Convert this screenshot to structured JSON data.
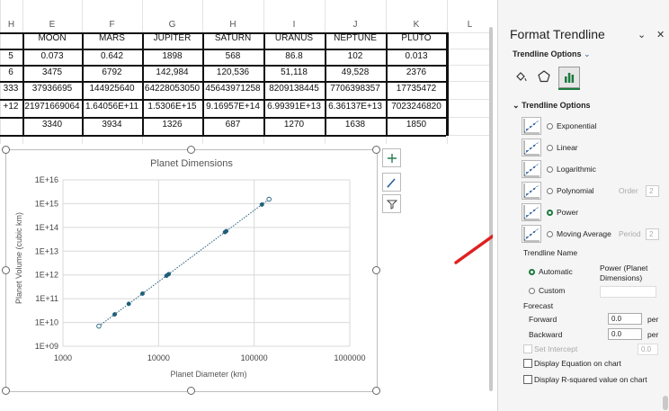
{
  "sheet": {
    "column_headers": [
      "H",
      "E",
      "F",
      "G",
      "H",
      "I",
      "J",
      "K",
      "L"
    ],
    "table_headers": [
      "MOON",
      "MARS",
      "JUPITER",
      "SATURN",
      "URANUS",
      "NEPTUNE",
      "PLUTO"
    ],
    "rows": [
      [
        "5",
        "0.073",
        "0.642",
        "1898",
        "568",
        "86.8",
        "102",
        "0.013"
      ],
      [
        "6",
        "3475",
        "6792",
        "142,984",
        "120,536",
        "51,118",
        "49,528",
        "2376"
      ],
      [
        "333",
        "37936695",
        "144925640",
        "64228053050",
        "45643971258",
        "8209138445",
        "7706398357",
        "17735472"
      ],
      [
        "+12",
        "21971669064",
        "1.64056E+11",
        "1.5306E+15",
        "9.16957E+14",
        "6.99391E+13",
        "6.36137E+13",
        "7023246820"
      ],
      [
        "",
        "3340",
        "3934",
        "1326",
        "687",
        "1270",
        "1638",
        "1850"
      ]
    ]
  },
  "chart": {
    "title": "Planet Dimensions",
    "xlabel": "Planet Diameter (km)",
    "ylabel": "Planet Volume (cubic km)"
  },
  "chart_data": {
    "type": "scatter",
    "title": "Planet Dimensions",
    "xlabel": "Planet Diameter (km)",
    "ylabel": "Planet Volume (cubic km)",
    "x_scale": "log",
    "y_scale": "log",
    "xlim": [
      1000,
      1000000
    ],
    "ylim": [
      1000000000,
      10000000000000000
    ],
    "x_ticks": [
      "1000",
      "10000",
      "100000",
      "1000000"
    ],
    "y_ticks": [
      "1E+09",
      "1E+10",
      "1E+11",
      "1E+12",
      "1E+13",
      "1E+14",
      "1E+15",
      "1E+16"
    ],
    "grid": true,
    "trendline": "power",
    "x": [
      2376,
      3475,
      4879,
      6792,
      12104,
      12756,
      49528,
      51118,
      120536,
      142984
    ],
    "y": [
      7023246820,
      21971669064,
      60830000000,
      164056000000,
      928400000000,
      1083000000000,
      63613700000000,
      69939100000000,
      916957000000000,
      1530600000000000
    ]
  },
  "pane": {
    "title": "Format Trendline",
    "tab_label": "Trendline Options",
    "section": "Trendline Options",
    "options": [
      {
        "label": "Exponential",
        "selected": false
      },
      {
        "label": "Linear",
        "selected": false
      },
      {
        "label": "Logarithmic",
        "selected": false
      },
      {
        "label": "Polynomial",
        "selected": false
      },
      {
        "label": "Power",
        "selected": true
      },
      {
        "label": "Moving Average",
        "selected": false
      }
    ],
    "order_label": "Order",
    "order_value": "2",
    "period_label": "Period",
    "period_value": "2",
    "name_label": "Trendline Name",
    "automatic_label": "Automatic",
    "automatic_value": "Power (Planet Dimensions)",
    "custom_label": "Custom",
    "forecast_label": "Forecast",
    "forward_label": "Forward",
    "forward_value": "0.0",
    "backward_label": "Backward",
    "backward_value": "0.0",
    "period_unit": "per",
    "intercept_label": "Set Intercept",
    "intercept_value": "0.0",
    "eq_label": "Display Equation on chart",
    "r2_label": "Display R-squared value on chart"
  },
  "colors": {
    "accent": "#1b7a3e",
    "marker": "#1f5f7a",
    "arrow": "#e02020"
  }
}
